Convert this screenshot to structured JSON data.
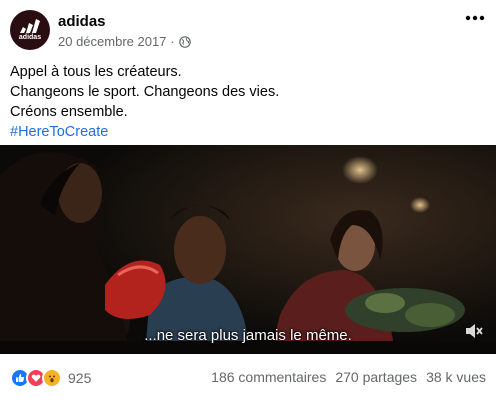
{
  "post": {
    "page_name": "adidas",
    "avatar_logo_text": "adidas",
    "date": "20 décembre 2017",
    "separator": "·",
    "privacy_icon": "globe-icon",
    "more_icon": "more-dots-icon",
    "text_lines": [
      "Appel à tous les créateurs.",
      "Changeons le sport. Changeons des vies.",
      "Créons ensemble."
    ],
    "hashtag": "#HereToCreate"
  },
  "video": {
    "subtitle": "...ne sera plus jamais le même.",
    "mute_icon": "speaker-muted-icon"
  },
  "footer": {
    "reaction_icons": [
      "like-icon",
      "love-icon",
      "wow-icon"
    ],
    "reaction_count": "925",
    "comments": "186 commentaires",
    "shares": "270 partages",
    "views": "38 k vues"
  },
  "colors": {
    "hashtag": "#216fdb",
    "secondary_text": "#65676b",
    "like": "#1877f2",
    "love": "#f33e58",
    "wow": "#f7b125"
  }
}
